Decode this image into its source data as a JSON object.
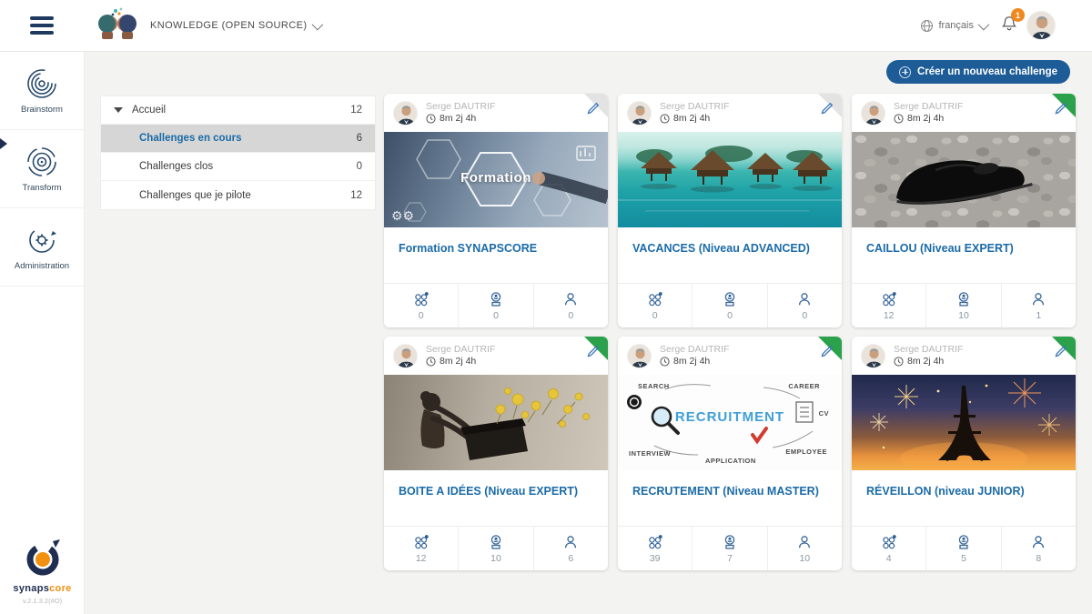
{
  "colors": {
    "accent_blue": "#1d5c97",
    "title_blue": "#1b6ba8",
    "active_green": "#2aa14a",
    "badge_orange": "#f0881e"
  },
  "header": {
    "context_title": "KNOWLEDGE (OPEN SOURCE)",
    "language": "français",
    "notification_count": "1"
  },
  "sidebar": {
    "items": [
      {
        "label": "Brainstorm",
        "icon": "spiral-icon",
        "active": true
      },
      {
        "label": "Transform",
        "icon": "target-icon",
        "active": false
      },
      {
        "label": "Administration",
        "icon": "gear-sync-icon",
        "active": false
      }
    ],
    "logo_word_1": "synaps",
    "logo_word_2": "core",
    "version": "v.2.1.3.2(#O)"
  },
  "actions": {
    "create_challenge": "Créer un nouveau challenge"
  },
  "filters": {
    "root": {
      "label": "Accueil",
      "count": "12"
    },
    "items": [
      {
        "label": "Challenges en cours",
        "count": "6",
        "selected": true
      },
      {
        "label": "Challenges clos",
        "count": "0",
        "selected": false
      },
      {
        "label": "Challenges que je pilote",
        "count": "12",
        "selected": false
      }
    ]
  },
  "stats_legend": [
    "ideas-icon",
    "award-icon",
    "participants-icon"
  ],
  "cards": [
    {
      "author": "Serge DAUTRIF",
      "time": "8m 2j 4h",
      "title": "Formation SYNAPSCORE",
      "corner": "gray",
      "stats": [
        "0",
        "0",
        "0"
      ],
      "image_label": "Formation"
    },
    {
      "author": "Serge DAUTRIF",
      "time": "8m 2j 4h",
      "title": "VACANCES (Niveau ADVANCED)",
      "corner": "gray",
      "stats": [
        "0",
        "0",
        "0"
      ]
    },
    {
      "author": "Serge DAUTRIF",
      "time": "8m 2j 4h",
      "title": "CAILLOU (Niveau EXPERT)",
      "corner": "green",
      "stats": [
        "12",
        "10",
        "1"
      ]
    },
    {
      "author": "Serge DAUTRIF",
      "time": "8m 2j 4h",
      "title": "BOITE A IDÉES (Niveau EXPERT)",
      "corner": "green",
      "stats": [
        "12",
        "10",
        "6"
      ]
    },
    {
      "author": "Serge DAUTRIF",
      "time": "8m 2j 4h",
      "title": "RECRUTEMENT (Niveau MASTER)",
      "corner": "green",
      "stats": [
        "39",
        "7",
        "10"
      ],
      "image_center": "RECRUITMENT",
      "image_words": [
        "SEARCH",
        "CAREER",
        "CV",
        "EMPLOYEE",
        "APPLICATION",
        "INTERVIEW"
      ]
    },
    {
      "author": "Serge DAUTRIF",
      "time": "8m 2j 4h",
      "title": "RÉVEILLON (niveau JUNIOR)",
      "corner": "green",
      "stats": [
        "4",
        "5",
        "8"
      ]
    }
  ]
}
